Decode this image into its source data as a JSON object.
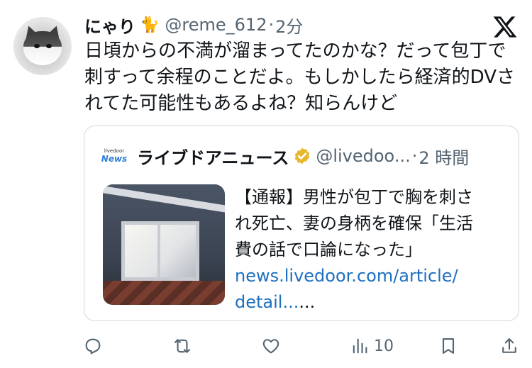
{
  "post": {
    "author_name": "にゃり",
    "author_emoji": "🐈",
    "handle": "@reme_612",
    "separator": "·",
    "time": "2分",
    "text_lines": [
      "日頃からの不満が溜まってたのかな？だって包丁で",
      "刺すって余程のことだよ。もしかしたら経済的DVさ",
      "れてた可能性もあるよね？知らんけど"
    ]
  },
  "quoted_card": {
    "source_logo_small": "livedoor",
    "source_logo_main": "News",
    "source_name": "ライブドアニュース",
    "handle": "@livedoo...",
    "separator": "·",
    "time": "2 時間",
    "headline_lines": [
      "【通報】男性が包丁で胸を刺さ",
      "れ死亡、妻の身柄を確保「生活",
      "費の話で口論になった」"
    ],
    "link_line1": "news.livedoor.com/article/",
    "link_line2": "detail...",
    "link_trail": "..."
  },
  "actions": {
    "views_count": "10"
  },
  "colors": {
    "text": "#0f1419",
    "muted": "#536471",
    "link": "#1d6fbf",
    "border": "#cfd9de",
    "verified_gold": "#e8b730"
  },
  "icons": [
    "x-logo-icon",
    "verified-badge-icon",
    "reply-icon",
    "repost-icon",
    "like-icon",
    "views-icon",
    "bookmark-icon",
    "share-icon"
  ]
}
